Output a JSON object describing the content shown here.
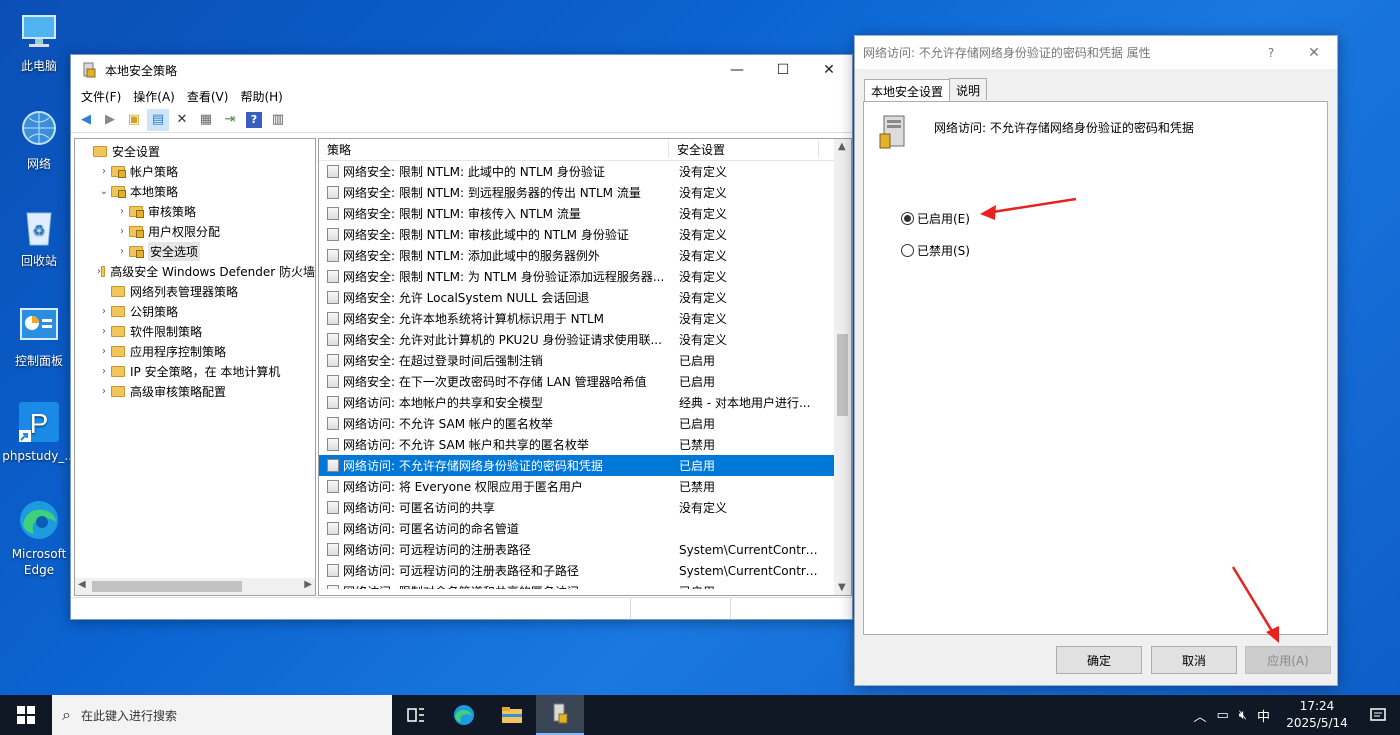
{
  "desktop": {
    "icons": [
      {
        "label": "此电脑"
      },
      {
        "label": "网络"
      },
      {
        "label": "回收站"
      },
      {
        "label": "控制面板"
      },
      {
        "label": "phpstudy_..."
      },
      {
        "label": "Microsoft Edge"
      }
    ]
  },
  "main_window": {
    "title": "本地安全策略",
    "menu": [
      "文件(F)",
      "操作(A)",
      "查看(V)",
      "帮助(H)"
    ],
    "tree": [
      {
        "label": "安全设置",
        "level": 0
      },
      {
        "label": "帐户策略",
        "level": 1
      },
      {
        "label": "本地策略",
        "level": 1
      },
      {
        "label": "审核策略",
        "level": 2
      },
      {
        "label": "用户权限分配",
        "level": 2
      },
      {
        "label": "安全选项",
        "level": 2,
        "selected": true
      },
      {
        "label": "高级安全 Windows Defender 防火墙",
        "level": 1
      },
      {
        "label": "网络列表管理器策略",
        "level": 1
      },
      {
        "label": "公钥策略",
        "level": 1
      },
      {
        "label": "软件限制策略",
        "level": 1
      },
      {
        "label": "应用程序控制策略",
        "level": 1
      },
      {
        "label": "IP 安全策略，在 本地计算机",
        "level": 1
      },
      {
        "label": "高级审核策略配置",
        "level": 1
      }
    ],
    "columns": {
      "policy": "策略",
      "setting": "安全设置"
    },
    "rows": [
      {
        "name": "网络安全: 限制 NTLM: 此域中的 NTLM 身份验证",
        "value": "没有定义"
      },
      {
        "name": "网络安全: 限制 NTLM: 到远程服务器的传出 NTLM 流量",
        "value": "没有定义"
      },
      {
        "name": "网络安全: 限制 NTLM: 审核传入 NTLM 流量",
        "value": "没有定义"
      },
      {
        "name": "网络安全: 限制 NTLM: 审核此域中的 NTLM 身份验证",
        "value": "没有定义"
      },
      {
        "name": "网络安全: 限制 NTLM: 添加此域中的服务器例外",
        "value": "没有定义"
      },
      {
        "name": "网络安全: 限制 NTLM: 为 NTLM 身份验证添加远程服务器...",
        "value": "没有定义"
      },
      {
        "name": "网络安全: 允许 LocalSystem NULL 会话回退",
        "value": "没有定义"
      },
      {
        "name": "网络安全: 允许本地系统将计算机标识用于 NTLM",
        "value": "没有定义"
      },
      {
        "name": "网络安全: 允许对此计算机的 PKU2U 身份验证请求使用联...",
        "value": "没有定义"
      },
      {
        "name": "网络安全: 在超过登录时间后强制注销",
        "value": "已启用"
      },
      {
        "name": "网络安全: 在下一次更改密码时不存储 LAN 管理器哈希值",
        "value": "已启用"
      },
      {
        "name": "网络访问: 本地帐户的共享和安全模型",
        "value": "经典 - 对本地用户进行..."
      },
      {
        "name": "网络访问: 不允许 SAM 帐户的匿名枚举",
        "value": "已启用"
      },
      {
        "name": "网络访问: 不允许 SAM 帐户和共享的匿名枚举",
        "value": "已禁用"
      },
      {
        "name": "网络访问: 不允许存储网络身份验证的密码和凭据",
        "value": "已启用",
        "selected": true
      },
      {
        "name": "网络访问: 将 Everyone 权限应用于匿名用户",
        "value": "已禁用"
      },
      {
        "name": "网络访问: 可匿名访问的共享",
        "value": "没有定义"
      },
      {
        "name": "网络访问: 可匿名访问的命名管道",
        "value": ""
      },
      {
        "name": "网络访问: 可远程访问的注册表路径",
        "value": "System\\CurrentContro..."
      },
      {
        "name": "网络访问: 可远程访问的注册表路径和子路径",
        "value": "System\\CurrentContro..."
      },
      {
        "name": "网络访问: 限制对命名管道和共享的匿名访问",
        "value": "已启用"
      }
    ]
  },
  "dialog": {
    "title": "网络访问: 不允许存储网络身份验证的密码和凭据 属性",
    "help": "?",
    "tabs": [
      "本地安全设置",
      "说明"
    ],
    "policy_name": "网络访问: 不允许存储网络身份验证的密码和凭据",
    "option_enabled": "已启用(E)",
    "option_disabled": "已禁用(S)",
    "selected_option": "enabled",
    "ok": "确定",
    "cancel": "取消",
    "apply": "应用(A)"
  },
  "taskbar": {
    "search_placeholder": "在此键入进行搜索",
    "ime": "中",
    "time": "17:24",
    "date": "2025/5/14"
  },
  "colors": {
    "selection": "#0078d7",
    "annotation_arrow": "#e8231f"
  }
}
